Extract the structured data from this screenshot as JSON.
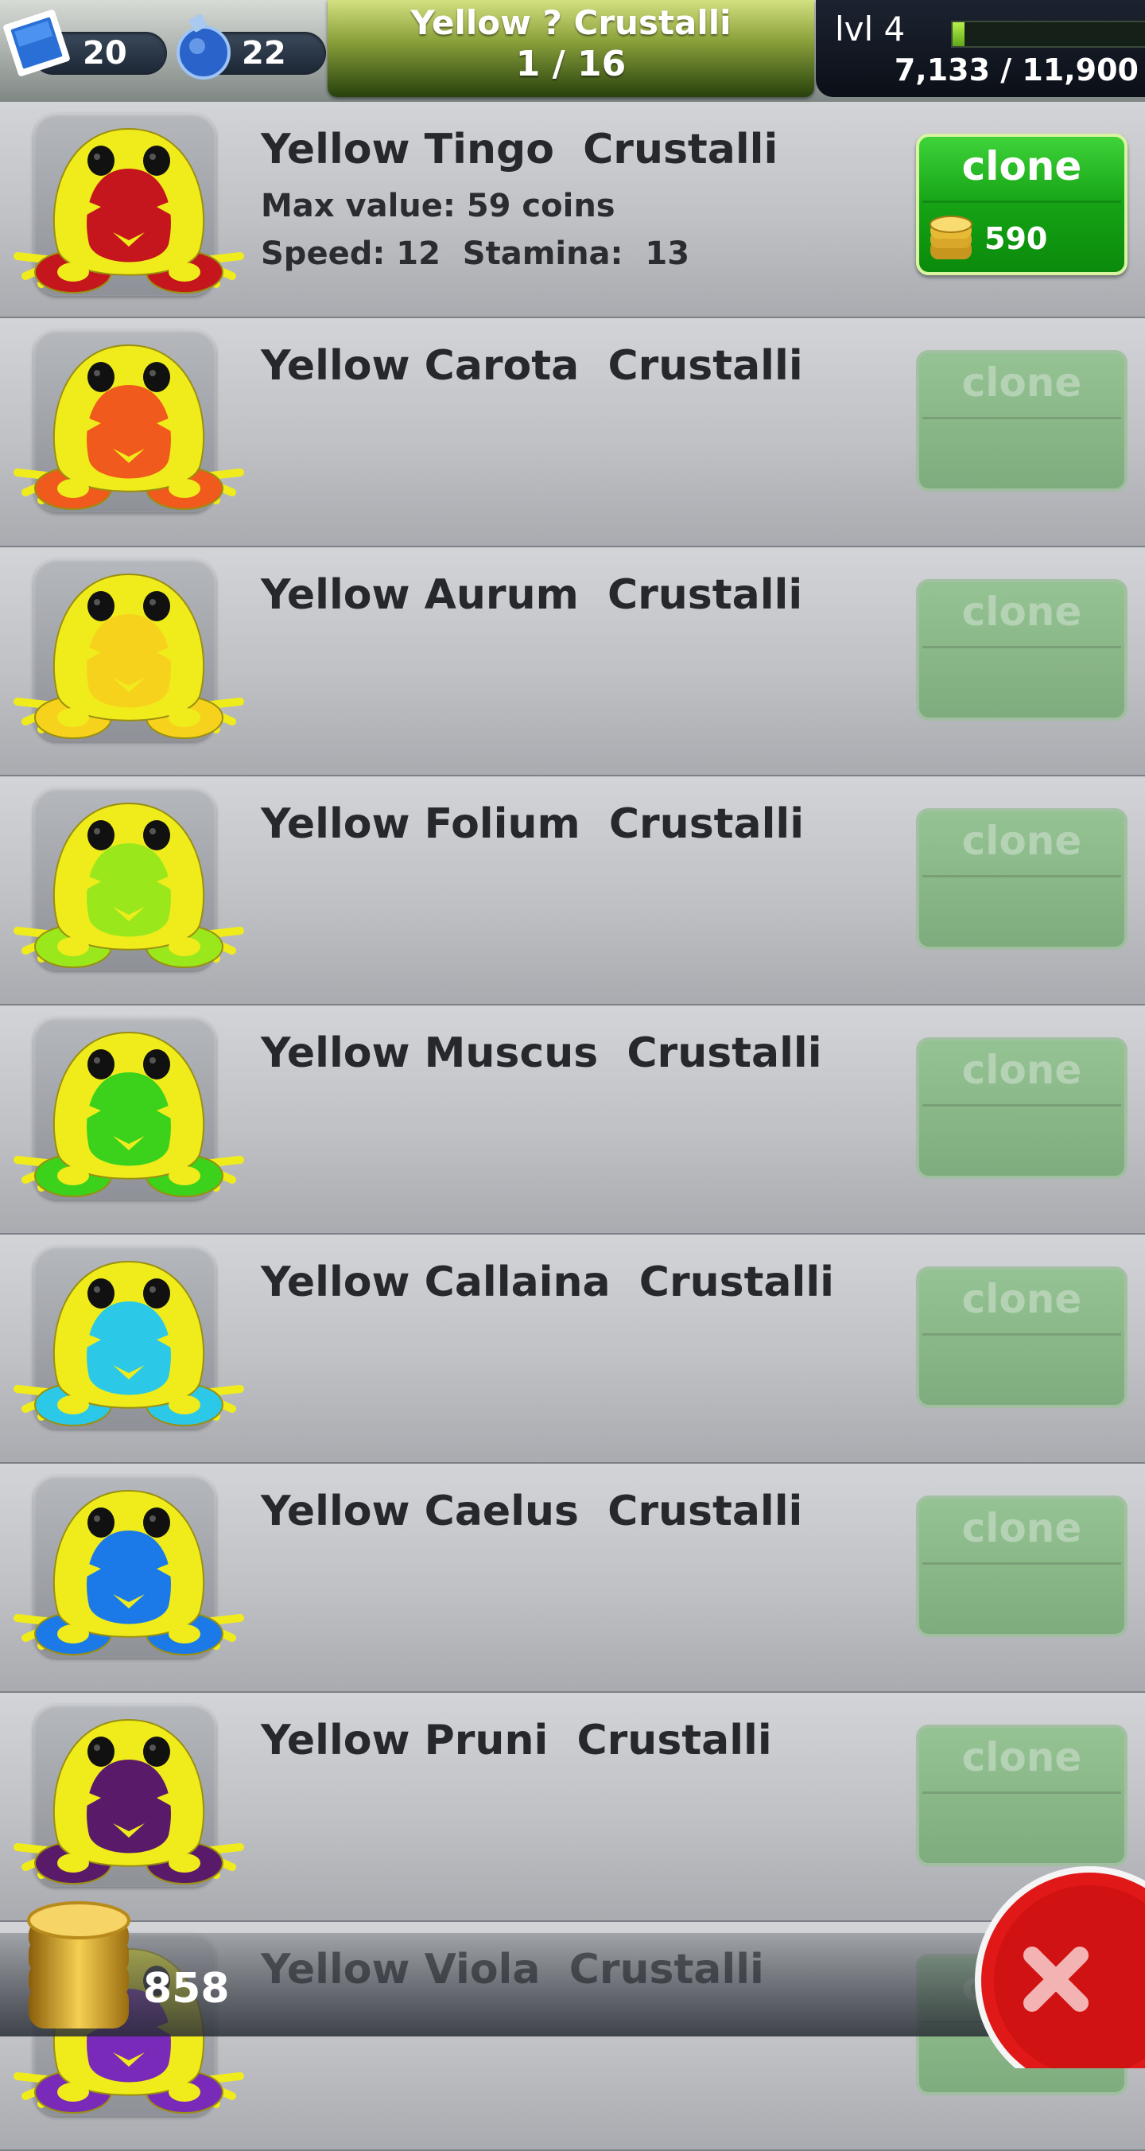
{
  "header": {
    "stamps_count": "20",
    "potions_count": "22",
    "title": "Yellow ? Crustalli",
    "page_indicator": "1 / 16",
    "level": "lvl 4",
    "xp_text": "7,133 / 11,900",
    "xp_fraction": 0.06
  },
  "frogs": [
    {
      "name": "Yellow Tingo  Crustalli",
      "max_value": "Max value: 59 coins",
      "stats": "Speed: 12  Stamina:  13",
      "clone_label": "clone",
      "price": "590",
      "enabled": true,
      "base": "#f0ec1c",
      "accent": "#c4161c"
    },
    {
      "name": "Yellow Carota  Crustalli",
      "clone_label": "clone",
      "enabled": false,
      "base": "#f0ec1c",
      "accent": "#f05a1c"
    },
    {
      "name": "Yellow Aurum  Crustalli",
      "clone_label": "clone",
      "enabled": false,
      "base": "#f0ec1c",
      "accent": "#f7d21c"
    },
    {
      "name": "Yellow Folium  Crustalli",
      "clone_label": "clone",
      "enabled": false,
      "base": "#f0ec1c",
      "accent": "#9ae81c"
    },
    {
      "name": "Yellow Muscus  Crustalli",
      "clone_label": "clone",
      "enabled": false,
      "base": "#f0ec1c",
      "accent": "#3cd21c"
    },
    {
      "name": "Yellow Callaina  Crustalli",
      "clone_label": "clone",
      "enabled": false,
      "base": "#f0ec1c",
      "accent": "#2cc8e8"
    },
    {
      "name": "Yellow Caelus  Crustalli",
      "clone_label": "clone",
      "enabled": false,
      "base": "#f0ec1c",
      "accent": "#1c7ae8"
    },
    {
      "name": "Yellow Pruni  Crustalli",
      "clone_label": "clone",
      "enabled": false,
      "base": "#f0ec1c",
      "accent": "#5a1a6a"
    },
    {
      "name": "Yellow Viola  Crustalli",
      "clone_label": "clone",
      "enabled": false,
      "base": "#f0ec1c",
      "accent": "#7a2ab8"
    }
  ],
  "footer": {
    "coins": "858"
  },
  "icons": {
    "stamp": "stamp-icon",
    "potion": "potion-icon",
    "coin": "coin-icon",
    "close": "close-icon"
  }
}
